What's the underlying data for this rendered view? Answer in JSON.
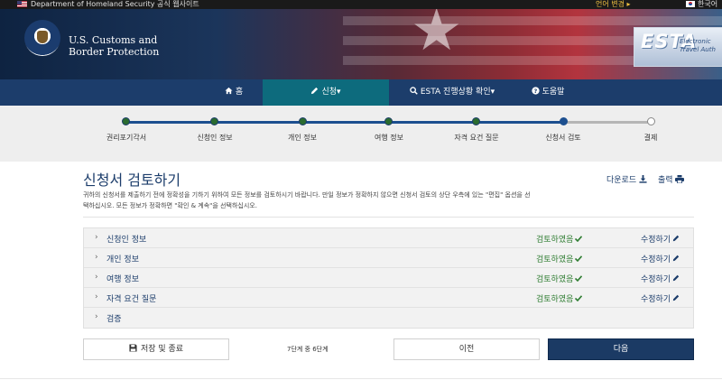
{
  "topbar": {
    "gov_notice": "Department of Homeland Security 공식 웹사이트",
    "language_change": "언어 변경 ▸",
    "language_current": "한국어"
  },
  "header": {
    "agency_line1": "U.S. Customs and",
    "agency_line2": "Border Protection",
    "esta_logo": "ESTA",
    "esta_sub1": "Electronic",
    "esta_sub2": "Travel Auth"
  },
  "nav": {
    "items": [
      {
        "label": "홈",
        "icon": "home-icon"
      },
      {
        "label": "신청",
        "icon": "pencil-icon"
      },
      {
        "label": "ESTA 진행상황 확인",
        "icon": "search-icon"
      },
      {
        "label": "도움말",
        "icon": "question-circle-icon"
      }
    ]
  },
  "progress": {
    "steps": [
      {
        "label": "권리포기각서",
        "state": "done"
      },
      {
        "label": "신청인 정보",
        "state": "done"
      },
      {
        "label": "개인 정보",
        "state": "done"
      },
      {
        "label": "여행 정보",
        "state": "done"
      },
      {
        "label": "자격 요건 질문",
        "state": "done"
      },
      {
        "label": "신청서 검토",
        "state": "current"
      },
      {
        "label": "결제",
        "state": "future"
      }
    ],
    "colors": {
      "track": "#1c4f8f",
      "done_dot": "#2a6b2f",
      "future_track": "#b5b5b5"
    }
  },
  "main": {
    "title": "신청서 검토하기",
    "download_label": "다운로드",
    "print_label": "출력",
    "intro_line1": "귀하의 신청서를 제출하기 전에 정확성을 기하기 위하여 모든 정보를 검토하시기 바랍니다. 만일 정보가 정확하지 않으면 신청서 검토의 상단 우측에 있는 \"편집\" 옵션을 선",
    "intro_line2": "택하십시오. 모든 정보가 정확하면 \"확인 & 계속\"을 선택하십시오.",
    "sections": [
      {
        "label": "신청인 정보",
        "status": "검토하였음",
        "edit": "수정하기"
      },
      {
        "label": "개인 정보",
        "status": "검토하였음",
        "edit": "수정하기"
      },
      {
        "label": "여행 정보",
        "status": "검토하였음",
        "edit": "수정하기"
      },
      {
        "label": "자격 요건 질문",
        "status": "검토하였음",
        "edit": "수정하기"
      },
      {
        "label": "검증",
        "status": "",
        "edit": ""
      }
    ]
  },
  "footer": {
    "save_exit": "저장 및 종료",
    "step_counter": "7단계 중 6단계",
    "previous": "이전",
    "next": "다음"
  }
}
